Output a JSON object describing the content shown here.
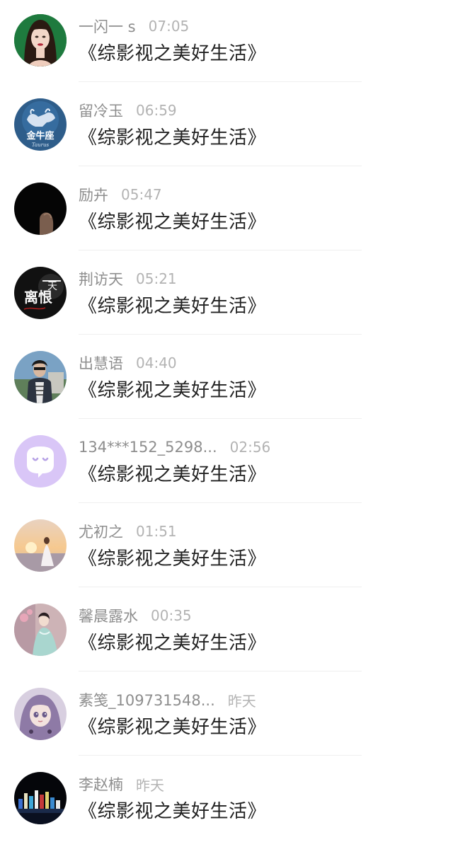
{
  "comments": [
    {
      "name": "一闪一 s",
      "time": "07:05",
      "text": "《综影视之美好生活》",
      "avatar": "woman-portrait-avatar"
    },
    {
      "name": "留冷玉",
      "time": "06:59",
      "text": "《综影视之美好生活》",
      "avatar": "taurus-zodiac-avatar",
      "avatar_text": "金牛座",
      "avatar_subtext": "Taurus"
    },
    {
      "name": "励卉",
      "time": "05:47",
      "text": "《综影视之美好生活》",
      "avatar": "dark-silhouette-avatar"
    },
    {
      "name": "荆访天",
      "time": "05:21",
      "text": "《综影视之美好生活》",
      "avatar": "calligraphy-avatar",
      "avatar_text": "离恨天"
    },
    {
      "name": "出慧语",
      "time": "04:40",
      "text": "《综影视之美好生活》",
      "avatar": "man-portrait-avatar"
    },
    {
      "name": "134***152_5298...",
      "time": "02:56",
      "text": "《综影视之美好生活》",
      "avatar": "default-chat-avatar"
    },
    {
      "name": "尤初之",
      "time": "01:51",
      "text": "《综影视之美好生活》",
      "avatar": "sunset-girl-avatar"
    },
    {
      "name": "馨晨露水",
      "time": "00:35",
      "text": "《综影视之美好生活》",
      "avatar": "hanfu-girl-avatar"
    },
    {
      "name": "素笺_109731548...",
      "time": "昨天",
      "text": "《综影视之美好生活》",
      "avatar": "anime-girl-avatar"
    },
    {
      "name": "李赵楠",
      "time": "昨天",
      "text": "《综影视之美好生活》",
      "avatar": "city-night-avatar"
    }
  ],
  "colors": {
    "name": "#8e8e8e",
    "time": "#b3b3b3",
    "text": "#222222",
    "divider": "#efefef",
    "default_avatar": "#d9c6f7"
  }
}
